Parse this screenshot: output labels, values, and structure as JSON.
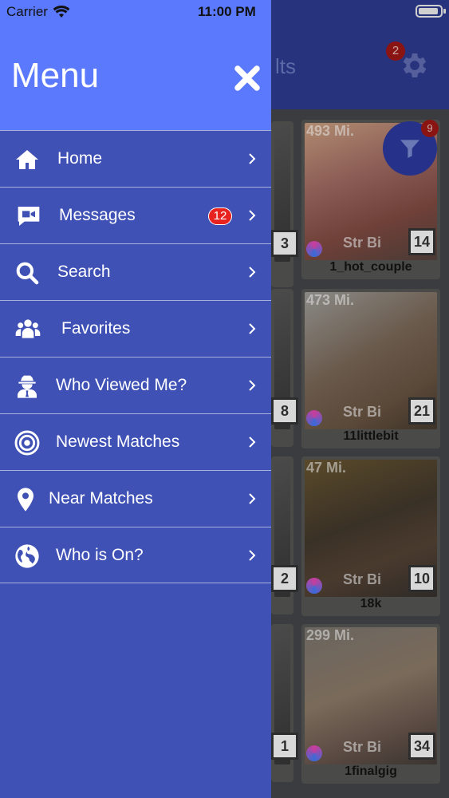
{
  "status_bar": {
    "carrier": "Carrier",
    "time": "11:00 PM"
  },
  "drawer": {
    "title": "Menu",
    "items": [
      {
        "label": "Home",
        "icon": "home-icon"
      },
      {
        "label": "Messages",
        "icon": "video-camera-icon",
        "badge": "12"
      },
      {
        "label": "Search",
        "icon": "search-icon"
      },
      {
        "label": "Favorites",
        "icon": "users-icon"
      },
      {
        "label": "Who Viewed Me?",
        "icon": "user-secret-icon"
      },
      {
        "label": "Newest Matches",
        "icon": "target-icon"
      },
      {
        "label": "Near Matches",
        "icon": "map-pin-icon"
      },
      {
        "label": "Who is On?",
        "icon": "globe-icon"
      }
    ]
  },
  "background": {
    "header_title_fragment": "lts",
    "settings_badge": "2",
    "filter_badge": "9",
    "cards": [
      {
        "distance": "493 Mi.",
        "orientation": "Str Bi",
        "photo_count": "14",
        "username": "1_hot_couple"
      },
      {
        "distance": "473 Mi.",
        "orientation": "Str Bi",
        "photo_count": "21",
        "username": "11littlebit"
      },
      {
        "distance": "47 Mi.",
        "orientation": "Str Bi",
        "photo_count": "10",
        "username": "18k"
      },
      {
        "distance": "299 Mi.",
        "orientation": "Str Bi",
        "photo_count": "34",
        "username": "1finalgig"
      }
    ],
    "left_column_counts": [
      "3",
      "8",
      "2",
      "1"
    ]
  },
  "colors": {
    "drawer_header": "#5b79fc",
    "drawer_body": "#3f51b5",
    "badge": "#e8231f",
    "bg_header": "#27337d"
  }
}
